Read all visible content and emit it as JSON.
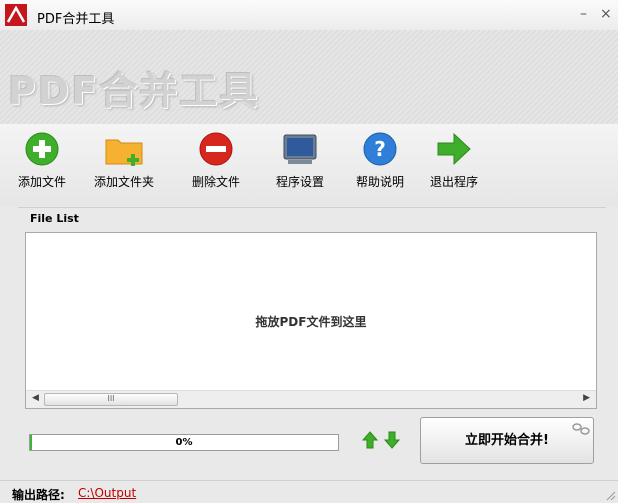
{
  "window": {
    "title": "PDF合并工具",
    "minimize_label": "–",
    "close_label": "×"
  },
  "banner": {
    "title": "PDF合并工具"
  },
  "toolbar": {
    "items": [
      {
        "label": "添加文件",
        "icon": "add-file-icon"
      },
      {
        "label": "添加文件夹",
        "icon": "add-folder-icon"
      },
      {
        "label": "删除文件",
        "icon": "delete-file-icon"
      },
      {
        "label": "程序设置",
        "icon": "settings-monitor-icon"
      },
      {
        "label": "帮助说明",
        "icon": "help-icon"
      },
      {
        "label": "退出程序",
        "icon": "exit-arrow-icon"
      }
    ]
  },
  "file_list": {
    "label": "File List",
    "empty_hint": "拖放PDF文件到这里",
    "scroll_thumb_grip": "III"
  },
  "progress": {
    "value": 0,
    "text": "0%"
  },
  "actions": {
    "start_label": "立即开始合并!"
  },
  "status": {
    "output_label": "输出路径:",
    "output_path": "C:\\Output"
  },
  "colors": {
    "brand_red": "#c4161c",
    "add_green": "#3fae2a",
    "delete_red": "#d7261d",
    "help_blue": "#2f7fd8",
    "progress_green": "#3bb53b",
    "path_red": "#c00000"
  }
}
